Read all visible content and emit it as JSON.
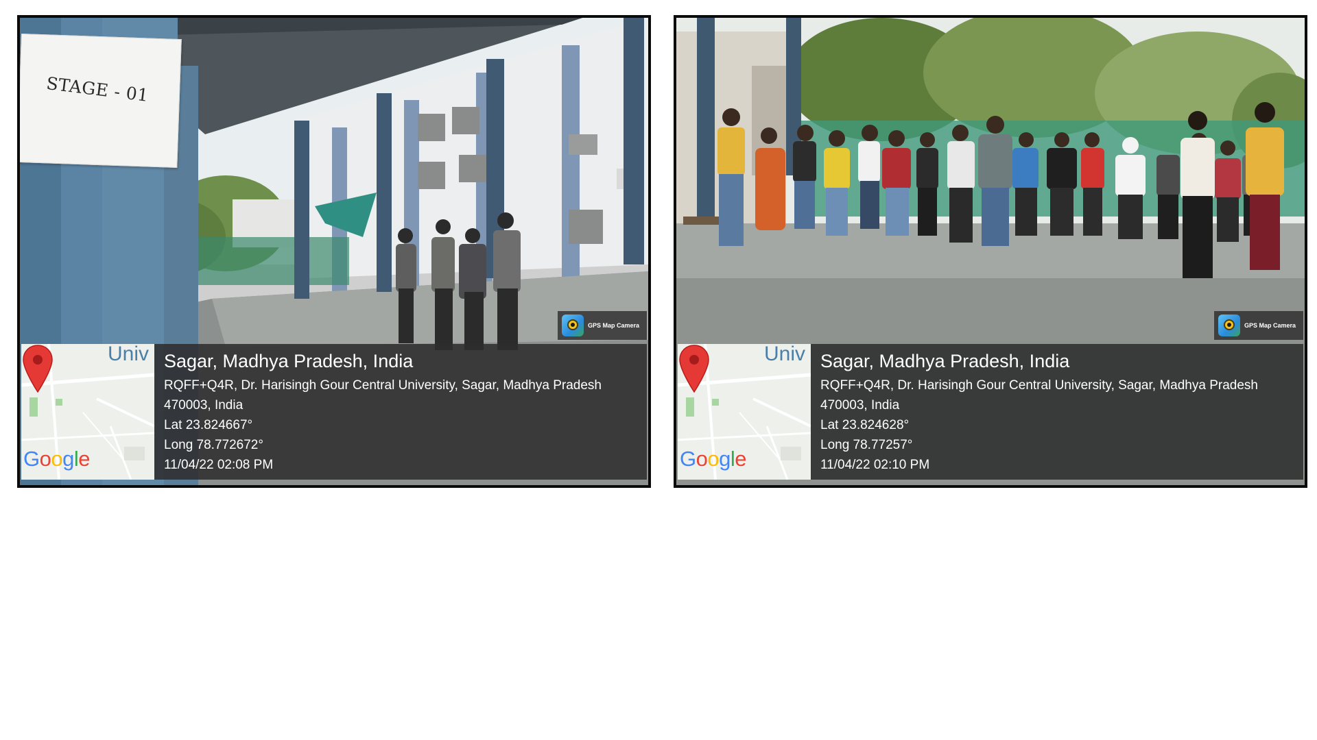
{
  "photos": [
    {
      "sign_text": "STAGE - 01",
      "gps_camera_label": "GPS Map Camera",
      "map": {
        "label": "Univ",
        "logo": "Google",
        "marker": "map-pin-icon"
      },
      "location": {
        "city": "Sagar, Madhya Pradesh, India",
        "address_line1": "RQFF+Q4R, Dr. Harisingh Gour Central University, Sagar, Madhya Pradesh",
        "address_line2": "470003, India",
        "lat": "Lat 23.824667°",
        "long": "Long 78.772672°",
        "datetime": "11/04/22 02:08 PM"
      }
    },
    {
      "gps_camera_label": "GPS Map Camera",
      "map": {
        "label": "Univ",
        "logo": "Google",
        "marker": "map-pin-icon"
      },
      "location": {
        "city": "Sagar, Madhya Pradesh, India",
        "address_line1": "RQFF+Q4R, Dr. Harisingh Gour Central University, Sagar, Madhya Pradesh",
        "address_line2": "470003, India",
        "lat": "Lat 23.824628°",
        "long": "Long 78.77257°",
        "datetime": "11/04/22 02:10 PM"
      }
    }
  ],
  "colors": {
    "frame": "#0a0a0a",
    "info_overlay": "#2d2d2d",
    "map_pin": "#e53935",
    "map_label": "#4a7fa8"
  }
}
